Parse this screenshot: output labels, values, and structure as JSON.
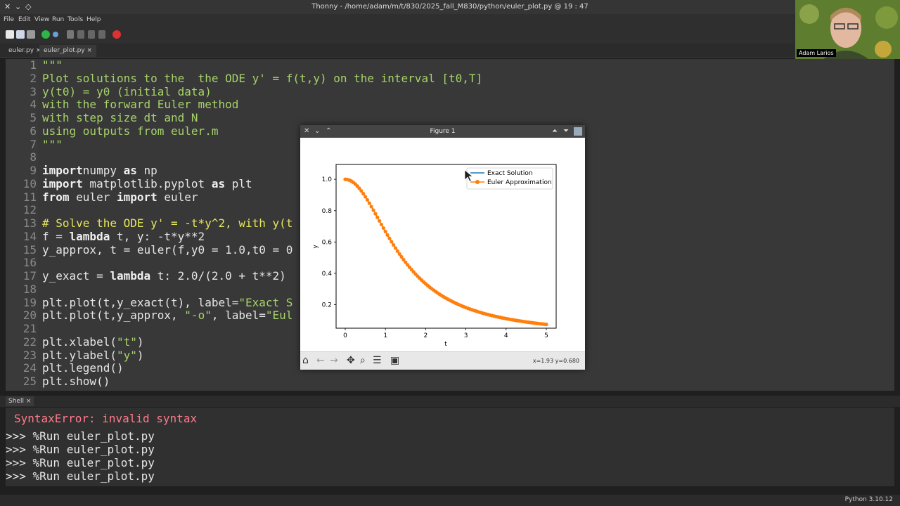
{
  "window": {
    "title": "Thonny - /home/adam/m/t/830/2025_fall_M830/python/euler_plot.py @ 19 : 47"
  },
  "menu": [
    "File",
    "Edit",
    "View",
    "Run",
    "Tools",
    "Help"
  ],
  "tabs": [
    {
      "label": "euler.py ×",
      "active": false
    },
    {
      "label": "euler_plot.py ×",
      "active": true
    }
  ],
  "editor": {
    "line_numbers": [
      "1",
      "2",
      "3",
      "4",
      "5",
      "6",
      "7",
      "8",
      "9",
      "10",
      "11",
      "12",
      "13",
      "14",
      "15",
      "16",
      "17",
      "18",
      "19",
      "20",
      "21",
      "22",
      "23",
      "24",
      "25"
    ],
    "lines": [
      [
        [
          "str",
          "\"\"\""
        ]
      ],
      [
        [
          "str",
          "Plot solutions to the  the ODE y' = f(t,y) on the interval [t0,T]"
        ]
      ],
      [
        [
          "str",
          "y(t0) = y0 (initial data)"
        ]
      ],
      [
        [
          "str",
          "with the forward Euler method"
        ]
      ],
      [
        [
          "str",
          "with step size dt and N"
        ]
      ],
      [
        [
          "str",
          "using outputs from euler.m"
        ]
      ],
      [
        [
          "str",
          "\"\"\""
        ]
      ],
      [],
      [
        [
          "kw",
          "import"
        ],
        [
          "",
          "numpy "
        ],
        [
          "kw",
          "as"
        ],
        [
          "",
          " np"
        ]
      ],
      [
        [
          "kw",
          "import"
        ],
        [
          "",
          " matplotlib.pyplot "
        ],
        [
          "kw",
          "as"
        ],
        [
          "",
          " plt"
        ]
      ],
      [
        [
          "kw",
          "from"
        ],
        [
          "",
          " euler "
        ],
        [
          "kw",
          "import"
        ],
        [
          "",
          " euler"
        ]
      ],
      [],
      [
        [
          "cm",
          "# Solve the ODE y' = -t*y^2, with y(t"
        ]
      ],
      [
        [
          "",
          "f = "
        ],
        [
          "kw",
          "lambda"
        ],
        [
          "",
          " t, y: -t*y**2"
        ]
      ],
      [
        [
          "",
          "y_approx, t = euler(f,y0 = 1.0,t0 = 0"
        ]
      ],
      [],
      [
        [
          "",
          "y_exact = "
        ],
        [
          "kw",
          "lambda"
        ],
        [
          "",
          " t: 2.0/(2.0 + t**2)"
        ]
      ],
      [],
      [
        [
          "",
          "plt.plot(t,y_exact(t), label="
        ],
        [
          "str",
          "\"Exact S"
        ]
      ],
      [
        [
          "",
          "plt.plot(t,y_approx, "
        ],
        [
          "str",
          "\"-o\""
        ],
        [
          "",
          ", label="
        ],
        [
          "str",
          "\"Eul"
        ]
      ],
      [],
      [
        [
          "",
          "plt.xlabel("
        ],
        [
          "str",
          "\"t\""
        ],
        [
          "",
          ")"
        ]
      ],
      [
        [
          "",
          "plt.ylabel("
        ],
        [
          "str",
          "\"y\""
        ],
        [
          "",
          ")"
        ]
      ],
      [
        [
          "",
          "plt.legend()"
        ]
      ],
      [
        [
          "",
          "plt.show()"
        ]
      ]
    ]
  },
  "shell": {
    "tab_label": "Shell ×",
    "error": "SyntaxError: invalid syntax",
    "prompts": [
      ">>> %Run euler_plot.py",
      ">>> %Run euler_plot.py",
      ">>> %Run euler_plot.py",
      ">>> %Run euler_plot.py"
    ]
  },
  "status": {
    "python_version": "Python 3.10.12"
  },
  "webcam": {
    "label": "Adam Larios"
  },
  "figure": {
    "title": "Figure 1",
    "coord_readout": "x=1.93 y=0.680"
  },
  "chart_data": {
    "type": "line",
    "xlabel": "t",
    "ylabel": "y",
    "xlim": [
      0,
      5
    ],
    "ylim": [
      0.05,
      1.05
    ],
    "xticks": [
      0,
      1,
      2,
      3,
      4,
      5
    ],
    "yticks": [
      0.2,
      0.4,
      0.6,
      0.8,
      1.0
    ],
    "legend_position": "top-right",
    "series": [
      {
        "name": "Exact Solution",
        "color": "#1f77b4",
        "style": "line",
        "formula": "2/(2+t^2)",
        "t_start": 0,
        "t_end": 5,
        "count": 101
      },
      {
        "name": "Euler Approximation",
        "color": "#ff7f0e",
        "style": "line-markers",
        "t_start": 0,
        "t_end": 5,
        "count": 101
      }
    ]
  },
  "colors": {
    "accent_orange": "#ff7f0e",
    "accent_blue": "#1f77b4"
  }
}
